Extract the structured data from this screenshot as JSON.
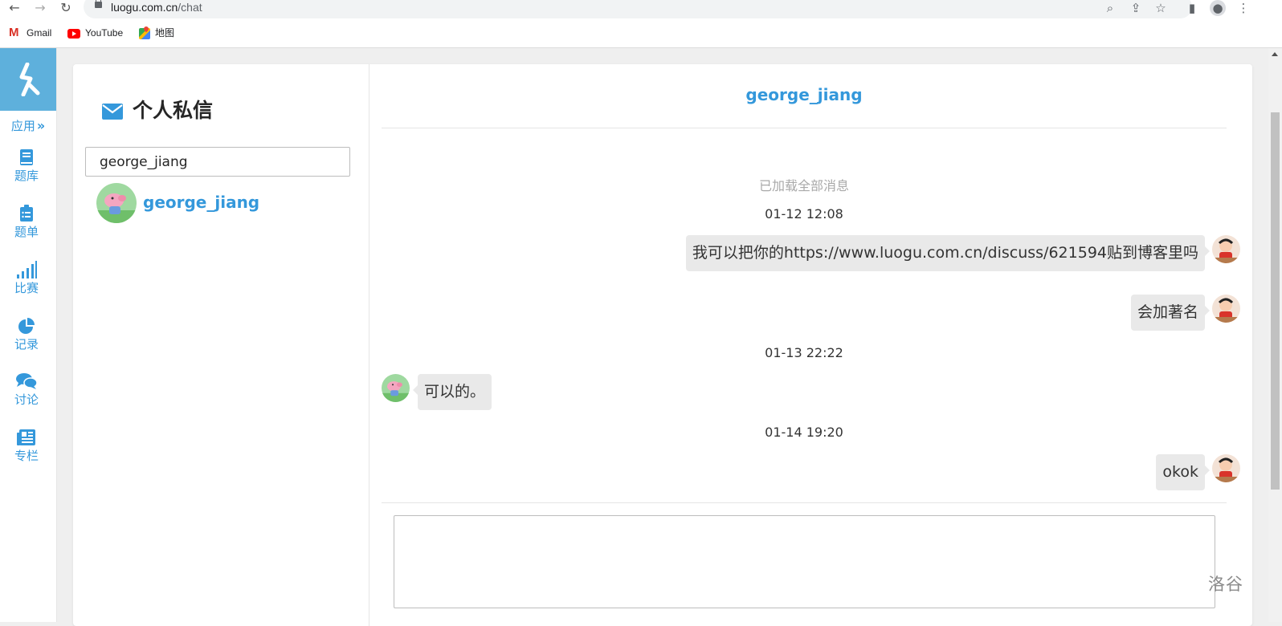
{
  "browser": {
    "url_host": "luogu.com.cn",
    "url_path": "/chat",
    "bookmarks": [
      "Gmail",
      "YouTube",
      "地图"
    ]
  },
  "sidebar": {
    "apps_label": "应用",
    "items": [
      {
        "label": "题库",
        "icon": "book-icon"
      },
      {
        "label": "题单",
        "icon": "clipboard-list-icon"
      },
      {
        "label": "比赛",
        "icon": "signal-bars-icon"
      },
      {
        "label": "记录",
        "icon": "pie-chart-icon"
      },
      {
        "label": "讨论",
        "icon": "comments-icon"
      },
      {
        "label": "专栏",
        "icon": "newspaper-icon"
      }
    ]
  },
  "inbox": {
    "title": "个人私信",
    "search_value": "george_jiang",
    "contacts": [
      {
        "name": "george_jiang"
      }
    ]
  },
  "chat": {
    "partner": "george_jiang",
    "loaded_notice": "已加载全部消息",
    "messages": [
      {
        "time": "01-12 12:08",
        "side": "right",
        "text": "我可以把你的https://www.luogu.com.cn/discuss/621594贴到博客里吗"
      },
      {
        "side": "right",
        "text": "会加著名"
      },
      {
        "time": "01-13 22:22",
        "side": "left",
        "text": "可以的。"
      },
      {
        "time": "01-14 19:20",
        "side": "right",
        "text": "okok"
      }
    ]
  },
  "watermark": "洛谷",
  "colors": {
    "accent": "#3498db",
    "logo_bg": "#5eb0dc",
    "bubble": "#e9e9e9"
  }
}
